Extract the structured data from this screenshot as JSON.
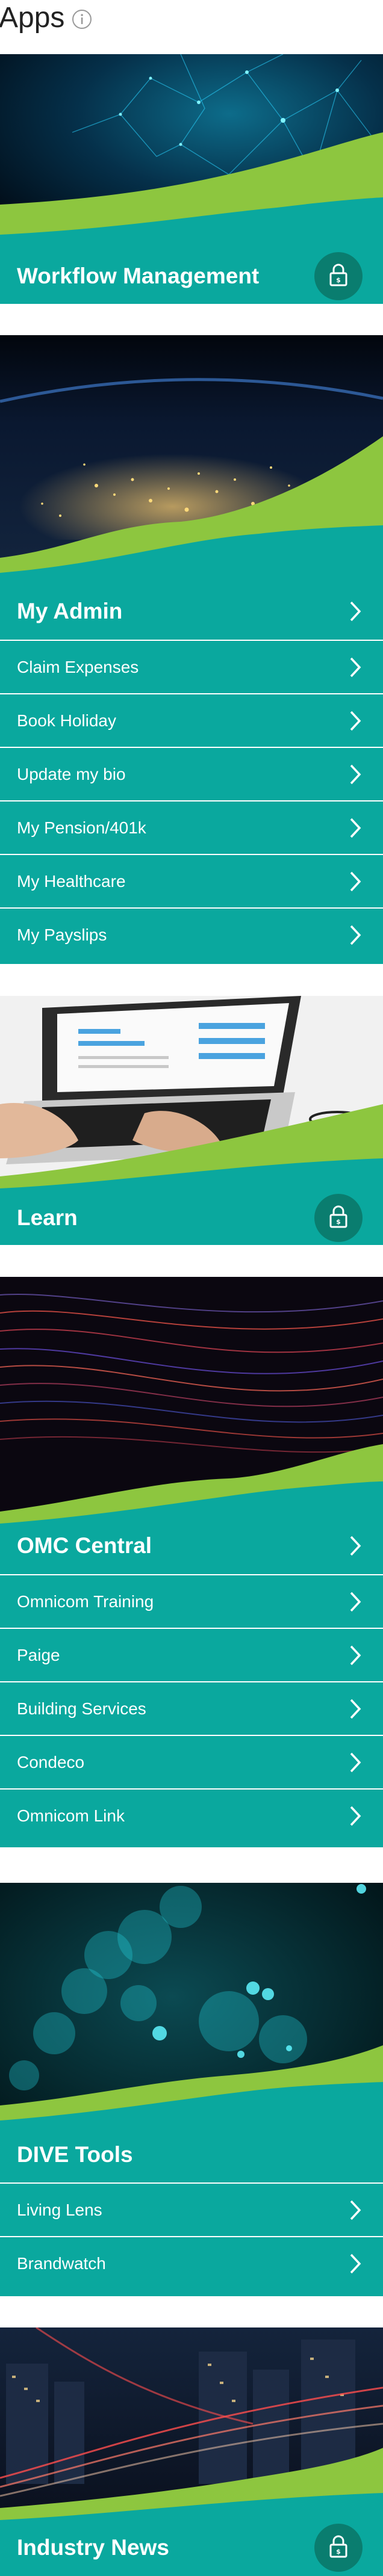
{
  "page": {
    "title": "Apps"
  },
  "cards": [
    {
      "title": "Workflow Management",
      "locked": true
    },
    {
      "title": "My Admin",
      "items": [
        "Claim Expenses",
        "Book Holiday",
        "Update my bio",
        "My Pension/401k",
        "My Healthcare",
        "My Payslips"
      ]
    },
    {
      "title": "Learn",
      "locked": true
    },
    {
      "title": "OMC Central",
      "items": [
        "Omnicom Training",
        "Paige",
        "Building Services",
        "Condeco",
        "Omnicom Link"
      ]
    },
    {
      "title": "DIVE Tools",
      "items": [
        "Living Lens",
        "Brandwatch"
      ]
    },
    {
      "title": "Industry News",
      "locked": true
    }
  ],
  "colors": {
    "teal": "#0aa89e",
    "green": "#8dc63f",
    "lock_bg": "#0a7d6f",
    "white": "#ffffff"
  },
  "icons": {
    "info": "info-icon",
    "lock": "lock-icon",
    "chevron": "chevron-right-icon"
  }
}
